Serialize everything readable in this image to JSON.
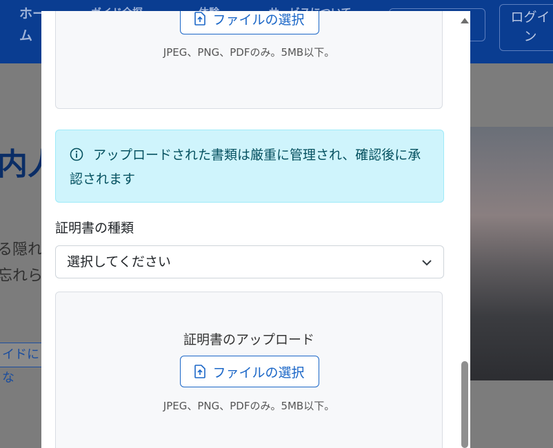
{
  "background": {
    "nav": [
      "ホー",
      "ム",
      "ガイド全探",
      "体験",
      "サービスについて"
    ],
    "login": [
      "ログイ",
      "ン"
    ],
    "hero_title": "内人",
    "hero_lines": [
      "る隠れ",
      "忘れら"
    ],
    "cta": "イドにな"
  },
  "modal": {
    "upload_top": {
      "button_label": "ファイルの選択",
      "hint": "JPEG、PNG、PDFのみ。5MB以下。"
    },
    "alert": {
      "icon": "info-circle-icon",
      "text": "アップロードされた書類は厳重に管理され、確認後に承認されます"
    },
    "certificate_type": {
      "label": "証明書の種類",
      "selected": "選択してください"
    },
    "upload_bottom": {
      "title": "証明書のアップロード",
      "button_label": "ファイルの選択",
      "hint": "JPEG、PNG、PDFのみ。5MB以下。"
    }
  },
  "colors": {
    "primary": "#1a66c7",
    "alert_bg": "#cff4fc",
    "alert_text": "#055160",
    "header_bg": "#0a3d91"
  }
}
